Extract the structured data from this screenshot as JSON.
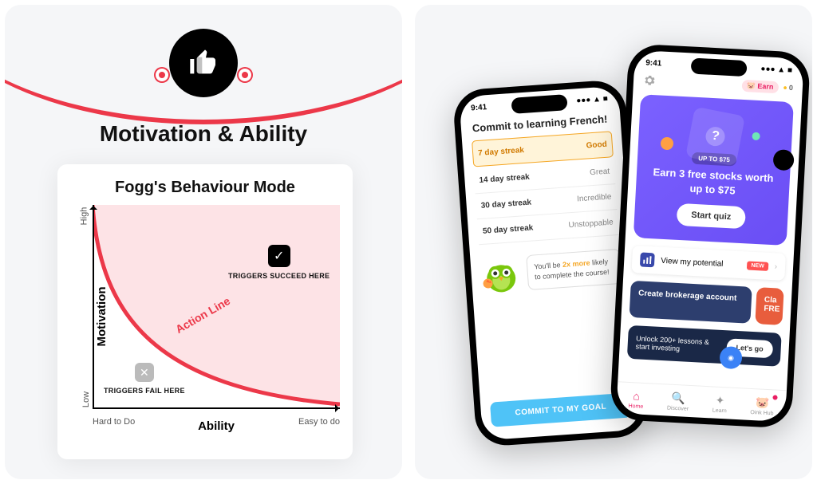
{
  "left": {
    "title": "Motivation & Ability",
    "chart": {
      "title": "Fogg's Behaviour Mode",
      "y_label": "Motivation",
      "x_label": "Ability",
      "y_high": "High",
      "y_low": "Low",
      "x_hard": "Hard to Do",
      "x_easy": "Easy to do",
      "action_line": "Action Line",
      "succeed": "TRIGGERS SUCCEED HERE",
      "fail": "TRIGGERS FAIL HERE"
    }
  },
  "phone1": {
    "time": "9:41",
    "heading": "Commit to learning French!",
    "streaks": [
      {
        "label": "7 day streak",
        "tag": "Good",
        "selected": true
      },
      {
        "label": "14 day streak",
        "tag": "Great"
      },
      {
        "label": "30 day streak",
        "tag": "Incredible"
      },
      {
        "label": "50 day streak",
        "tag": "Unstoppable"
      }
    ],
    "speech_pre": "You'll be ",
    "speech_bold": "2x more",
    "speech_post": " likely to complete the course!",
    "commit": "COMMIT TO MY GOAL"
  },
  "phone2": {
    "time": "9:41",
    "earn": "Earn",
    "coins": "0",
    "promo_badge": "UP TO $75",
    "promo_title": "Earn 3 free stocks worth up to $75",
    "quiz": "Start quiz",
    "potential": "View my potential",
    "new": "NEW",
    "card1": "Create brokerage account",
    "card2": "Cla FRE",
    "unlock": "Unlock 200+ lessons & start investing",
    "letsgo": "Let's go",
    "tabs": [
      {
        "label": "Home",
        "active": true
      },
      {
        "label": "Discover"
      },
      {
        "label": "Learn"
      },
      {
        "label": "Oink Hub",
        "dot": true
      }
    ]
  },
  "chart_data": {
    "type": "line",
    "title": "Fogg's Behaviour Model — Action Line",
    "xlabel": "Ability",
    "ylabel": "Motivation",
    "x": [
      0,
      0.1,
      0.2,
      0.3,
      0.4,
      0.5,
      0.6,
      0.7,
      0.8,
      0.9,
      1.0
    ],
    "values": [
      1.0,
      0.62,
      0.44,
      0.33,
      0.25,
      0.19,
      0.15,
      0.11,
      0.08,
      0.05,
      0.03
    ],
    "xlim": [
      0,
      1
    ],
    "ylim": [
      0,
      1
    ],
    "regions": [
      {
        "name": "Triggers succeed",
        "side": "above"
      },
      {
        "name": "Triggers fail",
        "side": "below"
      }
    ],
    "x_ticks": [
      "Hard to Do",
      "Easy to do"
    ],
    "y_ticks": [
      "Low",
      "High"
    ]
  }
}
